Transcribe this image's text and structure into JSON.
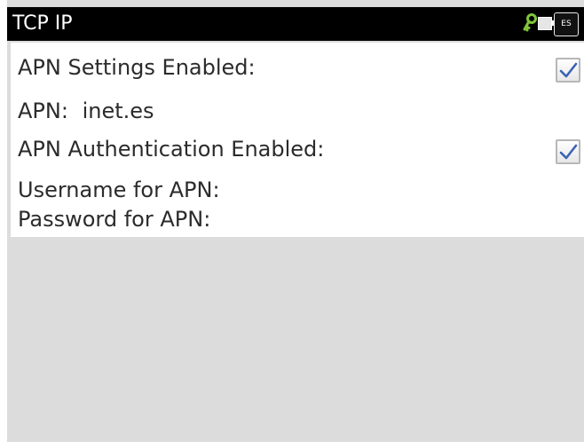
{
  "app": {
    "title": "TCP IP",
    "status": {
      "language_badge": "ES",
      "key_icon": "key-icon",
      "battery_icon": "battery-icon"
    }
  },
  "settings": {
    "apn_settings_enabled": {
      "label": "APN Settings Enabled:",
      "checked": true
    },
    "apn": {
      "label": "APN:",
      "value": "inet.es"
    },
    "apn_auth_enabled": {
      "label": "APN Authentication Enabled:",
      "checked": true
    },
    "username": {
      "label": "Username for APN:",
      "value": ""
    },
    "password": {
      "label": "Password for APN:",
      "value": ""
    }
  },
  "colors": {
    "titlebar": "#000000",
    "panel": "#ffffff",
    "background": "#dcdcdc",
    "checkmark": "#3b62b5",
    "key_icon": "#7fc43a"
  }
}
